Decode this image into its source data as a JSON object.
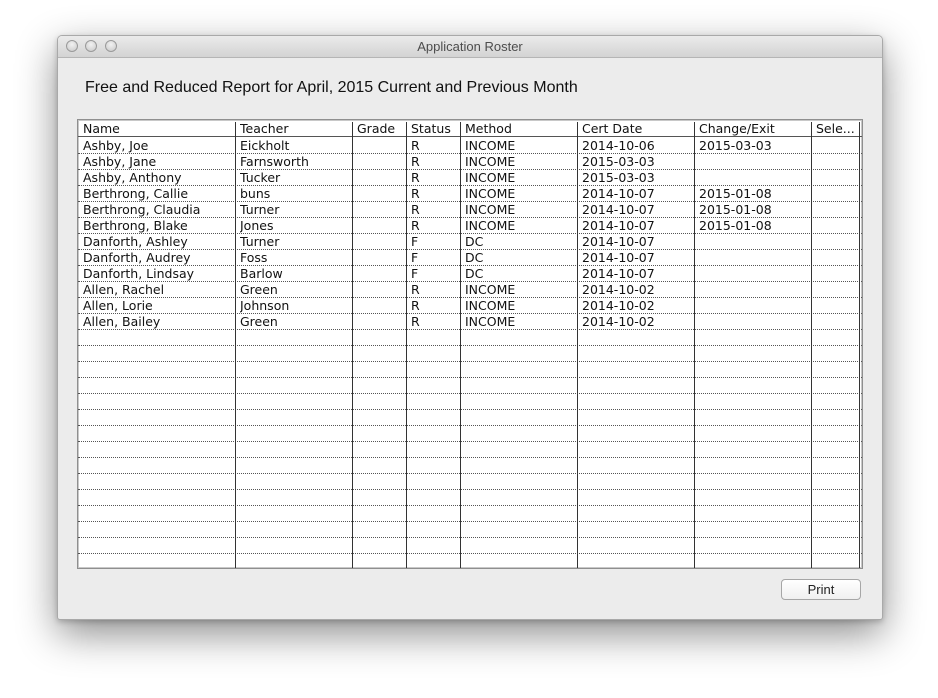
{
  "window": {
    "title": "Application Roster"
  },
  "report": {
    "title": "Free and Reduced Report for April, 2015 Current and Previous Month"
  },
  "table": {
    "columns": [
      "Name",
      "Teacher",
      "Grade",
      "Status",
      "Method",
      "Cert Date",
      "Change/Exit",
      "Sele..."
    ],
    "rows": [
      {
        "name": "Ashby, Joe",
        "teacher": "Eickholt",
        "grade": "",
        "status": "R",
        "method": "INCOME",
        "cert_date": "2014-10-06",
        "change_exit": "2015-03-03",
        "selected": ""
      },
      {
        "name": "Ashby, Jane",
        "teacher": "Farnsworth",
        "grade": "",
        "status": "R",
        "method": "INCOME",
        "cert_date": "2015-03-03",
        "change_exit": "",
        "selected": ""
      },
      {
        "name": "Ashby, Anthony",
        "teacher": "Tucker",
        "grade": "",
        "status": "R",
        "method": "INCOME",
        "cert_date": "2015-03-03",
        "change_exit": "",
        "selected": ""
      },
      {
        "name": "Berthrong, Callie",
        "teacher": "buns",
        "grade": "",
        "status": "R",
        "method": "INCOME",
        "cert_date": "2014-10-07",
        "change_exit": "2015-01-08",
        "selected": ""
      },
      {
        "name": "Berthrong, Claudia",
        "teacher": "Turner",
        "grade": "",
        "status": "R",
        "method": "INCOME",
        "cert_date": "2014-10-07",
        "change_exit": "2015-01-08",
        "selected": ""
      },
      {
        "name": "Berthrong, Blake",
        "teacher": "Jones",
        "grade": "",
        "status": "R",
        "method": "INCOME",
        "cert_date": "2014-10-07",
        "change_exit": "2015-01-08",
        "selected": ""
      },
      {
        "name": "Danforth, Ashley",
        "teacher": "Turner",
        "grade": "",
        "status": "F",
        "method": "DC",
        "cert_date": "2014-10-07",
        "change_exit": "",
        "selected": ""
      },
      {
        "name": "Danforth, Audrey",
        "teacher": "Foss",
        "grade": "",
        "status": "F",
        "method": "DC",
        "cert_date": "2014-10-07",
        "change_exit": "",
        "selected": ""
      },
      {
        "name": "Danforth, Lindsay",
        "teacher": "Barlow",
        "grade": "",
        "status": "F",
        "method": "DC",
        "cert_date": "2014-10-07",
        "change_exit": "",
        "selected": ""
      },
      {
        "name": "Allen, Rachel",
        "teacher": "Green",
        "grade": "",
        "status": "R",
        "method": "INCOME",
        "cert_date": "2014-10-02",
        "change_exit": "",
        "selected": ""
      },
      {
        "name": "Allen, Lorie",
        "teacher": "Johnson",
        "grade": "",
        "status": "R",
        "method": "INCOME",
        "cert_date": "2014-10-02",
        "change_exit": "",
        "selected": ""
      },
      {
        "name": "Allen, Bailey",
        "teacher": "Green",
        "grade": "",
        "status": "R",
        "method": "INCOME",
        "cert_date": "2014-10-02",
        "change_exit": "",
        "selected": ""
      }
    ]
  },
  "buttons": {
    "print_label": "Print"
  }
}
